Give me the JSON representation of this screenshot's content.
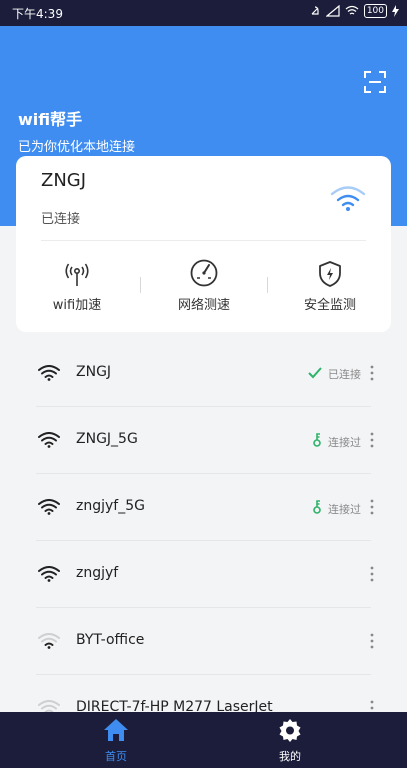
{
  "status": {
    "time": "下午4:39",
    "battery": "100"
  },
  "header": {
    "title": "wifi帮手",
    "subtitle": "已为你优化本地连接"
  },
  "current": {
    "name": "ZNGJ",
    "status": "已连接",
    "actions": [
      {
        "label": "wifi加速",
        "icon": "broadcast-icon"
      },
      {
        "label": "网络测速",
        "icon": "speedometer-icon"
      },
      {
        "label": "安全监测",
        "icon": "shield-bolt-icon"
      }
    ]
  },
  "networks": [
    {
      "ssid": "ZNGJ",
      "state": "已连接",
      "state_icon": "check-icon",
      "signal": 4
    },
    {
      "ssid": "ZNGJ_5G",
      "state": "连接过",
      "state_icon": "key-icon",
      "signal": 4
    },
    {
      "ssid": "zngjyf_5G",
      "state": "连接过",
      "state_icon": "key-icon",
      "signal": 4
    },
    {
      "ssid": "zngjyf",
      "state": "",
      "state_icon": "",
      "signal": 4
    },
    {
      "ssid": "BYT-office",
      "state": "",
      "state_icon": "",
      "signal": 2
    },
    {
      "ssid": "DIRECT-7f-HP M277 LaserJet",
      "state": "",
      "state_icon": "",
      "signal": 1
    }
  ],
  "tabs": [
    {
      "label": "首页",
      "icon": "home-icon",
      "active": true
    },
    {
      "label": "我的",
      "icon": "gear-icon",
      "active": false
    }
  ],
  "colors": {
    "accent": "#3f8df0",
    "dark": "#1b1d3a",
    "success": "#2fb36a",
    "tab_active": "#3f8df0",
    "tab_inactive": "#ffffff"
  }
}
